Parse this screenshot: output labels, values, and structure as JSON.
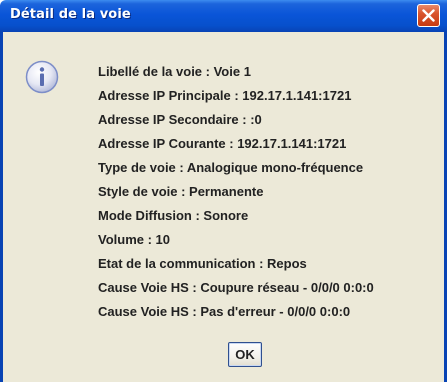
{
  "window": {
    "title": "Détail de la voie"
  },
  "icons": {
    "dialog_icon": "info-icon",
    "close_icon": "close-icon"
  },
  "details": [
    "Libellé de la voie   : Voie 1",
    "Adresse IP Principale : 192.17.1.141:1721",
    "Adresse IP Secondaire : :0",
    "Adresse IP Courante : 192.17.1.141:1721",
    "Type de voie : Analogique mono-fréquence",
    "Style de voie : Permanente",
    "Mode Diffusion : Sonore",
    "Volume : 10",
    "Etat de la communication : Repos",
    "Cause Voie HS : Coupure réseau - 0/0/0 0:0:0",
    "Cause Voie HS : Pas d'erreur - 0/0/0 0:0:0"
  ],
  "buttons": {
    "ok_label": "OK"
  },
  "colors": {
    "titlebar": "#0a55d8",
    "close_button": "#d9552e",
    "dialog_background": "#ece9d8",
    "info_icon": "#7d8ec8"
  }
}
